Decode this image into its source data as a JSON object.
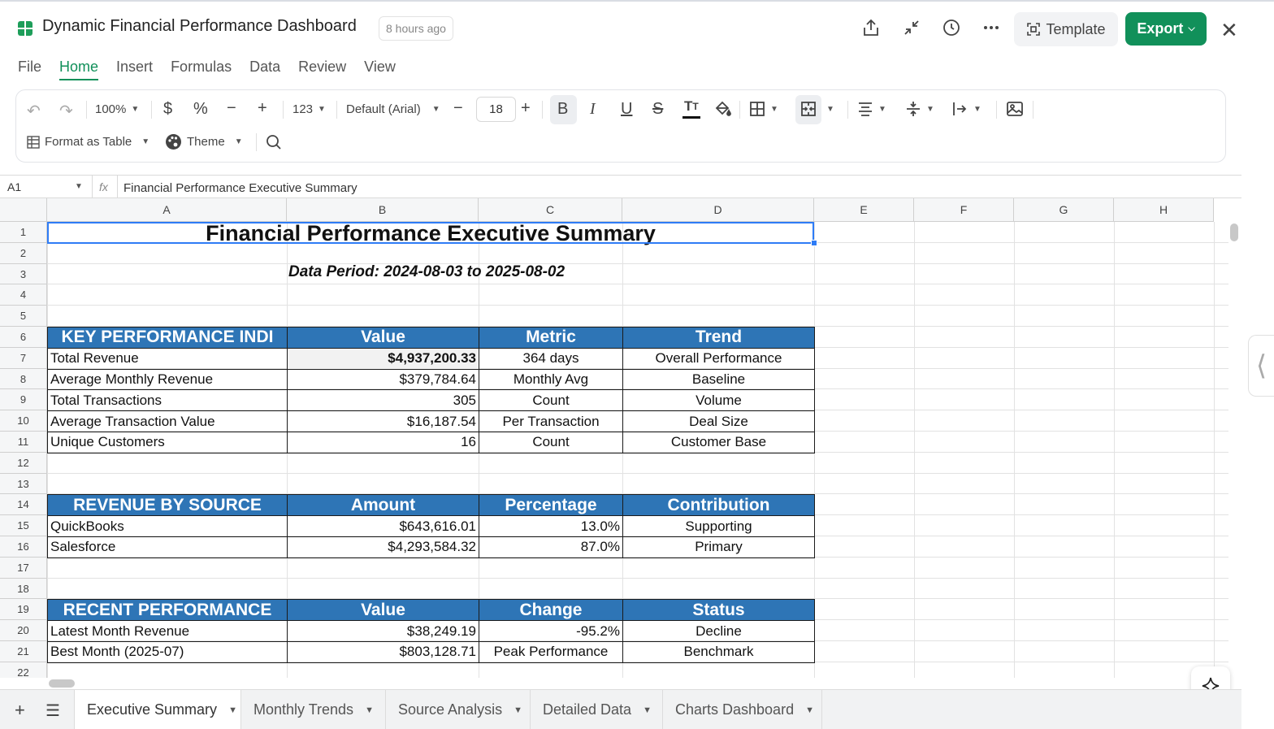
{
  "window": {
    "title": "Dynamic Financial Performance Dashboard",
    "time_badge": "8 hours ago",
    "template_label": "Template",
    "export_label": "Export"
  },
  "menu": [
    "File",
    "Home",
    "Insert",
    "Formulas",
    "Data",
    "Review",
    "View"
  ],
  "toolbar": {
    "zoom": "100%",
    "number_format": "123",
    "font_name": "Default (Arial)",
    "font_size": "18",
    "format_as_table": "Format as Table",
    "theme": "Theme"
  },
  "formula_bar": {
    "cell_ref": "A1",
    "fx": "fx",
    "content": "Financial Performance Executive Summary"
  },
  "columns": [
    "A",
    "B",
    "C",
    "D",
    "E",
    "F",
    "G",
    "H"
  ],
  "rows": [
    "1",
    "2",
    "3",
    "4",
    "5",
    "6",
    "7",
    "8",
    "9",
    "10",
    "11",
    "12",
    "13",
    "14",
    "15",
    "16",
    "17",
    "18",
    "19",
    "20",
    "21",
    "22"
  ],
  "sheet": {
    "title": "Financial Performance Executive Summary",
    "period": "Data Period: 2024-08-03 to 2025-08-02",
    "kpi": {
      "headers": [
        "KEY PERFORMANCE INDI",
        "Value",
        "Metric",
        "Trend"
      ],
      "rows": [
        [
          "Total Revenue",
          "$4,937,200.33",
          "364 days",
          "Overall Performance"
        ],
        [
          "Average Monthly Revenue",
          "$379,784.64",
          "Monthly Avg",
          "Baseline"
        ],
        [
          "Total Transactions",
          "305",
          "Count",
          "Volume"
        ],
        [
          "Average Transaction Value",
          "$16,187.54",
          "Per Transaction",
          "Deal Size"
        ],
        [
          "Unique Customers",
          "16",
          "Count",
          "Customer Base"
        ]
      ]
    },
    "revenue": {
      "headers": [
        "REVENUE BY SOURCE",
        "Amount",
        "Percentage",
        "Contribution"
      ],
      "rows": [
        [
          "QuickBooks",
          "$643,616.01",
          "13.0%",
          "Supporting"
        ],
        [
          "Salesforce",
          "$4,293,584.32",
          "87.0%",
          "Primary"
        ]
      ]
    },
    "recent": {
      "headers": [
        "RECENT PERFORMANCE",
        "Value",
        "Change",
        "Status"
      ],
      "rows": [
        [
          "Latest Month Revenue",
          "$38,249.19",
          "-95.2%",
          "Decline"
        ],
        [
          "Best Month (2025-07)",
          "$803,128.71",
          "Peak Performance",
          "Benchmark"
        ]
      ]
    }
  },
  "sheet_tabs": [
    "Executive Summary",
    "Monthly Trends",
    "Source Analysis",
    "Detailed Data",
    "Charts Dashboard"
  ],
  "colors": {
    "brand_green": "#11905a",
    "header_blue": "#2e75b6",
    "selection_blue": "#2e7cf6"
  }
}
